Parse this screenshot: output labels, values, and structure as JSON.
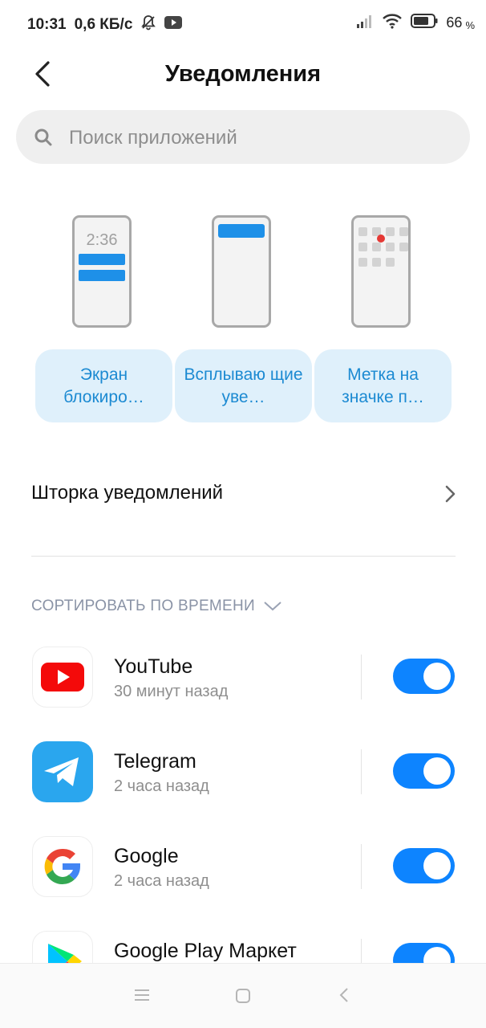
{
  "status": {
    "time": "10:31",
    "speed": "0,6 КБ/с",
    "battery": "66",
    "battery_pct": "%"
  },
  "header": {
    "title": "Уведомления"
  },
  "search": {
    "placeholder": "Поиск приложений"
  },
  "styles": {
    "lock_time": "2:36",
    "items": [
      {
        "label": "Экран блокиро…"
      },
      {
        "label": "Всплываю щие уве…"
      },
      {
        "label": "Метка на значке п…"
      }
    ]
  },
  "shade": {
    "label": "Шторка уведомлений"
  },
  "sort": {
    "label": "СОРТИРОВАТЬ ПО ВРЕМЕНИ"
  },
  "apps": [
    {
      "name": "YouTube",
      "time": "30 минут назад",
      "enabled": true,
      "icon": "youtube-icon"
    },
    {
      "name": "Telegram",
      "time": "2 часа назад",
      "enabled": true,
      "icon": "telegram-icon"
    },
    {
      "name": "Google",
      "time": "2 часа назад",
      "enabled": true,
      "icon": "google-icon"
    },
    {
      "name": "Google Play Маркет",
      "time": "",
      "enabled": true,
      "icon": "google-play-icon"
    }
  ],
  "colors": {
    "accent": "#0d84ff",
    "chip_bg": "#dff0fb",
    "chip_text": "#1c8ad2"
  }
}
